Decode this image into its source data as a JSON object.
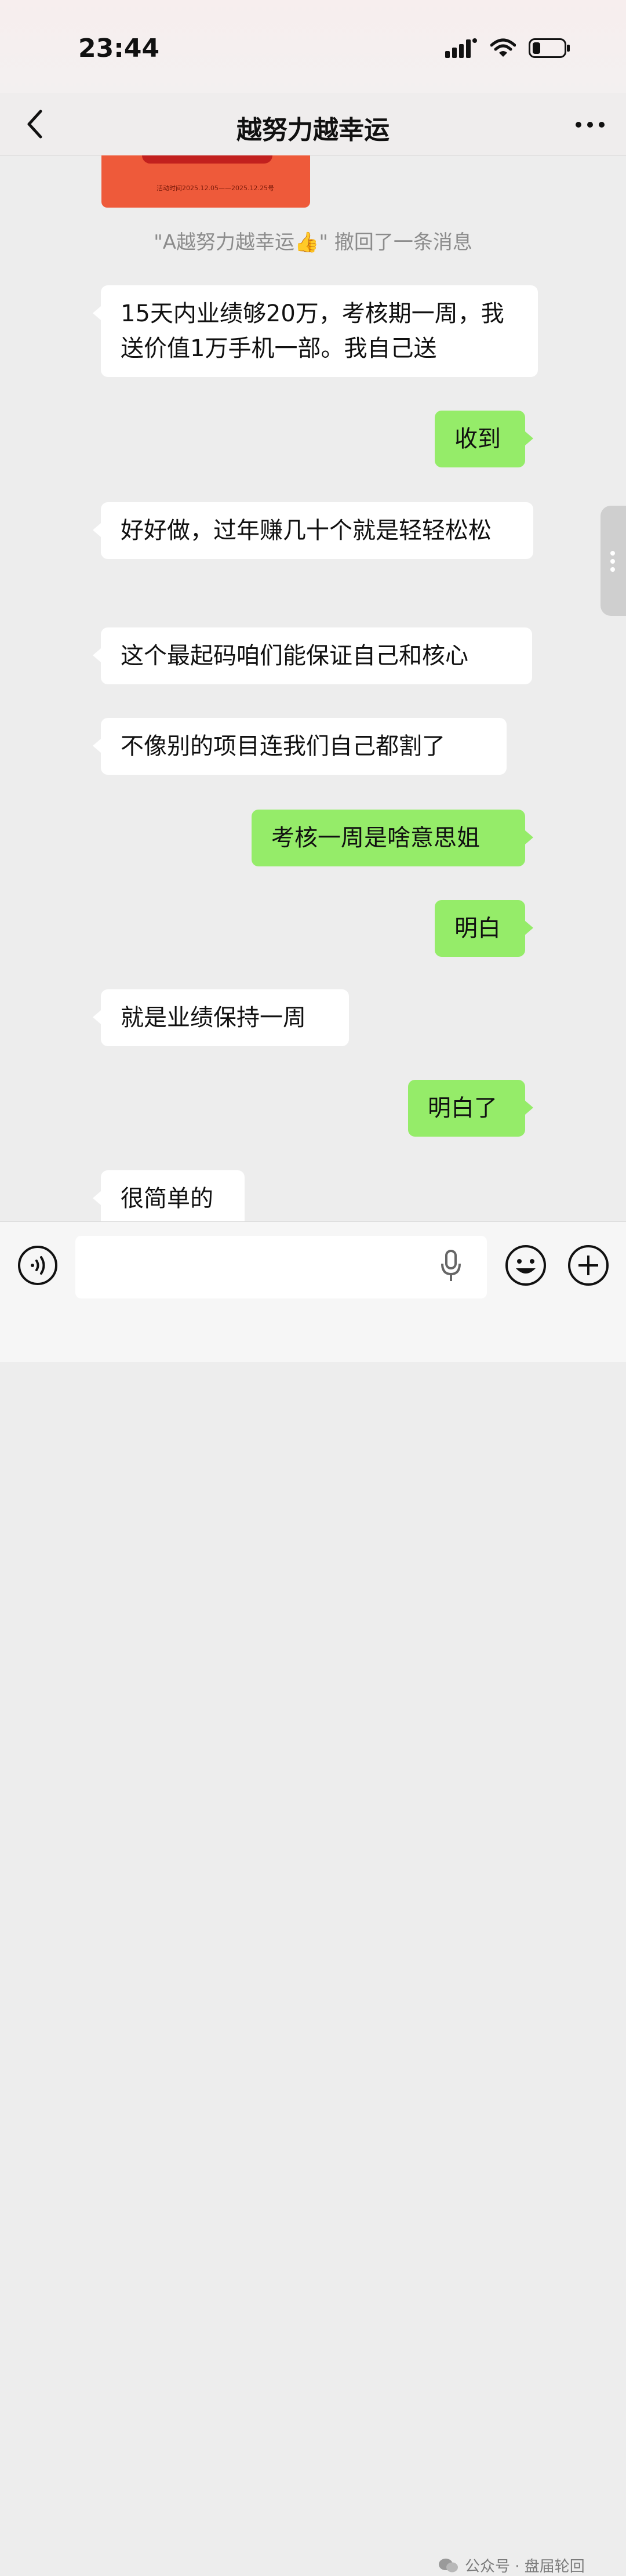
{
  "status": {
    "time": "23:44"
  },
  "header": {
    "title": "越努力越幸运",
    "back_icon": "chevron-left-icon",
    "more_icon": "more-dots-icon"
  },
  "poster": {
    "caption": "活动时间2025.12.05——2025.12.25号"
  },
  "recall_notice": "\"A越努力越幸运👍\" 撤回了一条消息",
  "messages": [
    {
      "from": "contact",
      "text": "15天内业绩够20万，考核期一周，我送价值1万手机一部。我自己送"
    },
    {
      "from": "me",
      "text": "收到"
    },
    {
      "from": "contact",
      "text": "好好做，过年赚几十个就是轻轻松松"
    },
    {
      "from": "contact",
      "text": "这个最起码咱们能保证自己和核心"
    },
    {
      "from": "contact",
      "text": "不像别的项目连我们自己都割了"
    },
    {
      "from": "me",
      "text": "考核一周是啥意思姐"
    },
    {
      "from": "me",
      "text": "明白"
    },
    {
      "from": "contact",
      "text": "就是业绩保持一周"
    },
    {
      "from": "me",
      "text": "明白了"
    },
    {
      "from": "contact",
      "text": "很简单的"
    }
  ],
  "input_bar": {
    "voice_icon": "voice-icon",
    "mic_icon": "mic-icon",
    "emoji_icon": "emoji-icon",
    "plus_icon": "plus-icon",
    "value": ""
  },
  "watermark": "公众号 · 盘届轮回",
  "colors": {
    "outgoing_bubble": "#95ec69",
    "incoming_bubble": "#ffffff",
    "background": "#ededed"
  }
}
